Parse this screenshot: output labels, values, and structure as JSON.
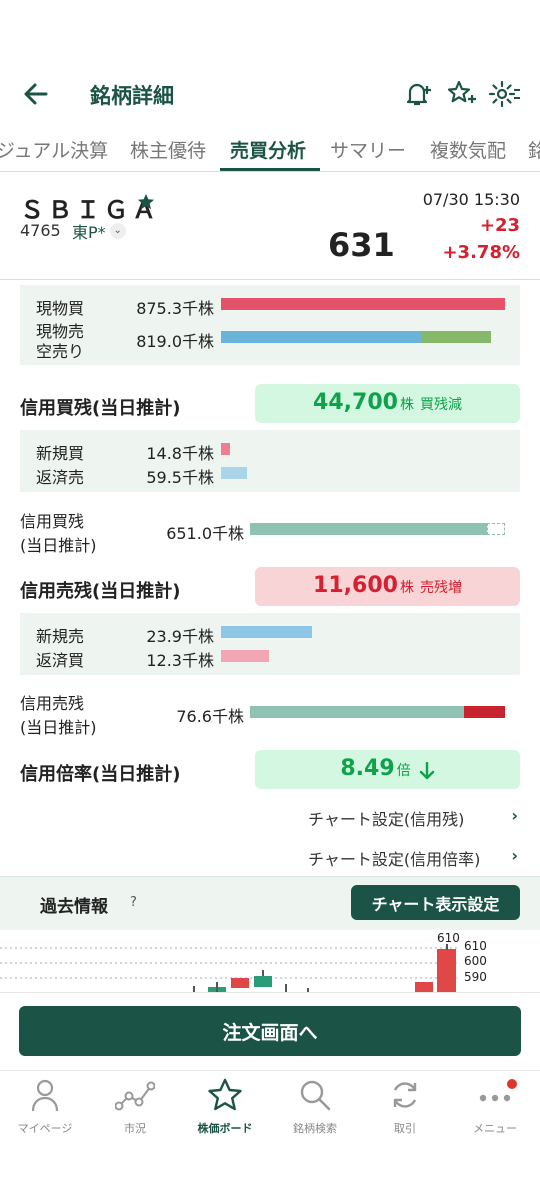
{
  "header": {
    "title": "銘柄詳細",
    "back_icon": "arrow-left-icon",
    "alert_icon": "bell-plus-icon",
    "favorite_icon": "star-plus-icon",
    "settings_icon": "gear-icon"
  },
  "tabs": [
    {
      "label": "ジュアル決算"
    },
    {
      "label": "株主優待"
    },
    {
      "label": "売買分析"
    },
    {
      "label": "サマリー"
    },
    {
      "label": "複数気配"
    },
    {
      "label": "銘"
    }
  ],
  "stock": {
    "name": "ＳＢＩＧＡ",
    "code": "4765",
    "market": "東P*",
    "datetime": "07/30 15:30",
    "price": "631",
    "change": "+23",
    "change_pct": "+3.78%"
  },
  "physical": {
    "buy_label": "現物買",
    "buy_value": "875.3千株",
    "buy_fraction": 1.0,
    "sell_label_1": "現物売",
    "sell_label_2": "空売り",
    "sell_value": "819.0千株",
    "sell_fraction": 0.71,
    "short_fraction": 0.24
  },
  "margin_buy": {
    "title": "信用買残(当日推計)",
    "amount": "44,700",
    "unit": "株",
    "status": "買残減",
    "new_label": "新規買",
    "new_value": "14.8千株",
    "new_fraction": 0.03,
    "repay_label": "返済売",
    "repay_value": "59.5千株",
    "repay_fraction": 0.1,
    "total_label_1": "信用買残",
    "total_label_2": "(当日推計)",
    "total_value": "651.0千株",
    "total_fraction": 0.93
  },
  "margin_sell": {
    "title": "信用売残(当日推計)",
    "amount": "11,600",
    "unit": "株",
    "status": "売残増",
    "new_label": "新規売",
    "new_value": "23.9千株",
    "new_fraction": 0.32,
    "repay_label": "返済買",
    "repay_value": "12.3千株",
    "repay_fraction": 0.16,
    "total_label_1": "信用売残",
    "total_label_2": "(当日推計)",
    "total_value": "76.6千株",
    "total_fraction": 0.85,
    "increase_fraction": 0.15
  },
  "margin_ratio": {
    "title": "信用倍率(当日推計)",
    "value": "8.49",
    "unit": "倍",
    "trend_icon": "arrow-down-icon"
  },
  "links": [
    {
      "label": "チャート設定(信用残)"
    },
    {
      "label": "チャート設定(信用倍率)"
    }
  ],
  "history": {
    "title": "過去情報",
    "help": "?",
    "chart_button": "チャート表示設定"
  },
  "mini_chart": {
    "labels": [
      "610",
      "610",
      "600",
      "590"
    ]
  },
  "order_button": "注文画面へ",
  "bottom_nav": [
    {
      "label": "マイページ",
      "icon": "person-icon"
    },
    {
      "label": "市況",
      "icon": "market-line-icon"
    },
    {
      "label": "株価ボード",
      "icon": "star-icon",
      "active": true
    },
    {
      "label": "銘柄検索",
      "icon": "search-icon"
    },
    {
      "label": "取引",
      "icon": "refresh-icon"
    },
    {
      "label": "メニュー",
      "icon": "more-dots-icon"
    }
  ],
  "colors": {
    "brand": "#1b5446",
    "buy": "#e5516a",
    "sell": "#6ab3d9",
    "short": "#86b86a",
    "margin": "#8fc2b2",
    "up": "#d6202f",
    "positive": "#0ea34a"
  }
}
